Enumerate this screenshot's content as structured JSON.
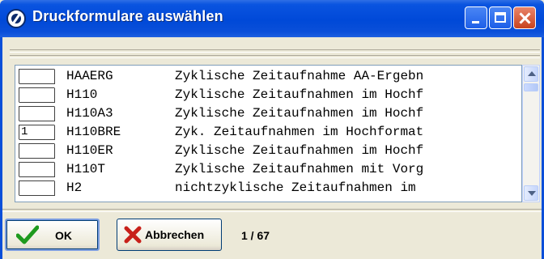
{
  "window": {
    "title": "Druckformulare auswählen",
    "accent_color": "#0a4fd9",
    "icon": "app-icon",
    "controls": [
      "minimize-icon",
      "maximize-icon",
      "close-icon"
    ]
  },
  "list": {
    "rows": [
      {
        "box": "",
        "code": "HAAERG",
        "description": "Zyklische Zeitaufnahme AA-Ergebn"
      },
      {
        "box": "",
        "code": "H110",
        "description": "Zyklische Zeitaufnahmen im Hochf"
      },
      {
        "box": "",
        "code": "H110A3",
        "description": "Zyklische Zeitaufnahmen im Hochf"
      },
      {
        "box": "1",
        "code": "H110BRE",
        "description": "Zyk. Zeitaufnahmen im Hochformat"
      },
      {
        "box": "",
        "code": "H110ER",
        "description": "Zyklische Zeitaufnahmen im Hochf"
      },
      {
        "box": "",
        "code": "H110T",
        "description": "Zyklische Zeitaufnahmen mit Vorg"
      },
      {
        "box": "",
        "code": "H2",
        "description": "nichtzyklische Zeitaufnahmen im "
      }
    ]
  },
  "footer": {
    "ok_label": "OK",
    "ok_icon": "check-icon",
    "cancel_label": "Abbrechen",
    "cancel_icon": "x-icon",
    "counter": "1 / 67"
  }
}
